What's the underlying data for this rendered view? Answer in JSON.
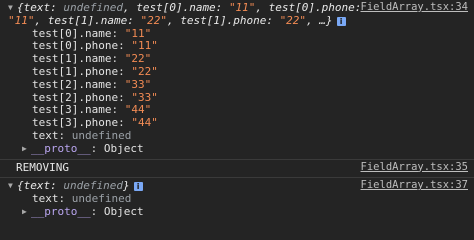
{
  "log1": {
    "source": "FieldArray.tsx:34",
    "summary_line1_a": "{text: ",
    "summary_line1_b": "undefined",
    "summary_line1_c": ", test[0].name: ",
    "summary_line1_d": "\"11\"",
    "summary_line1_e": ", test[0].phone: ",
    "summary_line1_f": "\"11\"",
    "summary_line1_g": ", test[1].name: ",
    "summary_line1_h": "\"22\"",
    "summary_line1_i": ", t",
    "summary_line2_a": "est[1].phone: ",
    "summary_line2_b": "\"22\"",
    "summary_line2_c": ", …}",
    "info_glyph": "i",
    "properties": [
      {
        "key": "test[0].name",
        "value": "\"11\""
      },
      {
        "key": "test[0].phone",
        "value": "\"11\""
      },
      {
        "key": "test[1].name",
        "value": "\"22\""
      },
      {
        "key": "test[1].phone",
        "value": "\"22\""
      },
      {
        "key": "test[2].name",
        "value": "\"33\""
      },
      {
        "key": "test[2].phone",
        "value": "\"33\""
      },
      {
        "key": "test[3].name",
        "value": "\"44\""
      },
      {
        "key": "test[3].phone",
        "value": "\"44\""
      }
    ],
    "text_key": "text",
    "text_value": "undefined",
    "proto_key": "__proto__",
    "proto_value": "Object"
  },
  "log2": {
    "source": "FieldArray.tsx:35",
    "message": "REMOVING"
  },
  "log3": {
    "source": "FieldArray.tsx:37",
    "summary_a": "{text: ",
    "summary_b": "undefined",
    "summary_c": "}",
    "info_glyph": "i",
    "text_key": "text",
    "text_value": "undefined",
    "proto_key": "__proto__",
    "proto_value": "Object"
  }
}
